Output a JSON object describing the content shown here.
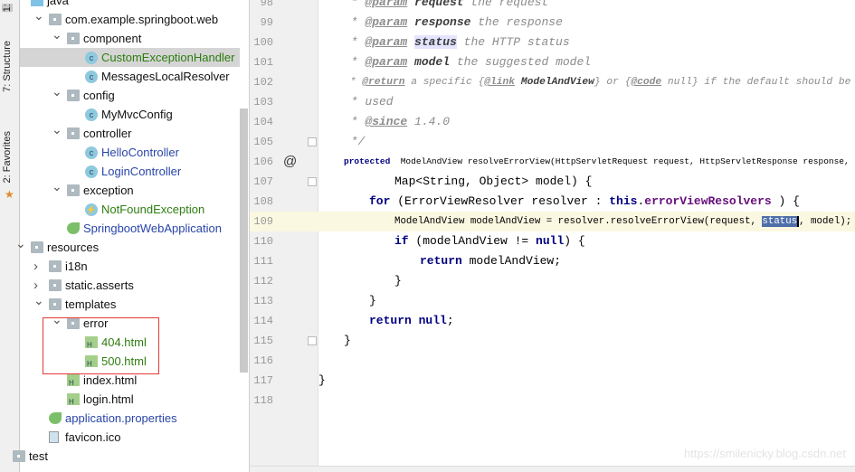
{
  "side_tabs": [
    {
      "label": "1:"
    },
    {
      "label": "7: Structure"
    },
    {
      "label": "2: Favorites"
    }
  ],
  "tree": [
    {
      "label": "java",
      "icon": "source-folder-icon",
      "text_x": 52,
      "arrow": "",
      "color": "black"
    },
    {
      "label": "com.example.springboot.web",
      "icon": "package-icon",
      "text_x": 72,
      "arrow": "down",
      "color": "black"
    },
    {
      "label": "component",
      "icon": "package-icon",
      "text_x": 92,
      "arrow": "down",
      "color": "black"
    },
    {
      "label": "CustomExceptionHandler",
      "icon": "class-icon",
      "text_x": 112,
      "arrow": "",
      "color": "green",
      "selected": true
    },
    {
      "label": "MessagesLocalResolver",
      "icon": "class-icon",
      "text_x": 112,
      "arrow": "",
      "color": "black"
    },
    {
      "label": "config",
      "icon": "package-icon",
      "text_x": 92,
      "arrow": "down",
      "color": "black"
    },
    {
      "label": "MyMvcConfig",
      "icon": "class-icon",
      "text_x": 112,
      "arrow": "",
      "color": "black"
    },
    {
      "label": "controller",
      "icon": "package-icon",
      "text_x": 92,
      "arrow": "down",
      "color": "black"
    },
    {
      "label": "HelloController",
      "icon": "class-icon",
      "text_x": 112,
      "arrow": "",
      "color": "blue"
    },
    {
      "label": "LoginController",
      "icon": "class-icon",
      "text_x": 112,
      "arrow": "",
      "color": "blue"
    },
    {
      "label": "exception",
      "icon": "package-icon",
      "text_x": 92,
      "arrow": "down",
      "color": "black"
    },
    {
      "label": "NotFoundException",
      "icon": "exception-class-icon",
      "text_x": 112,
      "arrow": "",
      "color": "green"
    },
    {
      "label": "SpringbootWebApplication",
      "icon": "spring-boot-app-icon",
      "text_x": 92,
      "arrow": "",
      "color": "blue"
    },
    {
      "label": "resources",
      "icon": "resources-folder-icon",
      "text_x": 52,
      "arrow": "down",
      "color": "black"
    },
    {
      "label": "i18n",
      "icon": "folder-icon",
      "text_x": 72,
      "arrow": "right",
      "color": "black"
    },
    {
      "label": "static.asserts",
      "icon": "folder-icon",
      "text_x": 72,
      "arrow": "right",
      "color": "black"
    },
    {
      "label": "templates",
      "icon": "folder-icon",
      "text_x": 72,
      "arrow": "down",
      "color": "black"
    },
    {
      "label": "error",
      "icon": "folder-icon",
      "text_x": 92,
      "arrow": "down",
      "color": "black"
    },
    {
      "label": "404.html",
      "icon": "html-file-icon",
      "text_x": 112,
      "arrow": "",
      "color": "green"
    },
    {
      "label": "500.html",
      "icon": "html-file-icon",
      "text_x": 112,
      "arrow": "",
      "color": "green"
    },
    {
      "label": "index.html",
      "icon": "html-file-icon",
      "text_x": 92,
      "arrow": "",
      "color": "black"
    },
    {
      "label": "login.html",
      "icon": "html-file-icon",
      "text_x": 92,
      "arrow": "",
      "color": "black"
    },
    {
      "label": "application.properties",
      "icon": "spring-properties-icon",
      "text_x": 72,
      "arrow": "",
      "color": "blue"
    },
    {
      "label": "favicon.ico",
      "icon": "image-file-icon",
      "text_x": 72,
      "arrow": "",
      "color": "black"
    },
    {
      "label": "test",
      "icon": "folder-icon",
      "text_x": 32,
      "arrow": "",
      "color": "black"
    }
  ],
  "editor": {
    "current_line": 109,
    "lines": [
      {
        "n": "98",
        "indent": 1,
        "tokens": [
          [
            "cm",
            " * "
          ],
          [
            "tag",
            "@param"
          ],
          [
            "cm",
            " "
          ],
          [
            "pn",
            "request"
          ],
          [
            "cm",
            " the request"
          ]
        ]
      },
      {
        "n": "99",
        "indent": 1,
        "tokens": [
          [
            "cm",
            " * "
          ],
          [
            "tag",
            "@param"
          ],
          [
            "cm",
            " "
          ],
          [
            "pn",
            "response"
          ],
          [
            "cm",
            " the response"
          ]
        ]
      },
      {
        "n": "100",
        "indent": 1,
        "tokens": [
          [
            "cm",
            " * "
          ],
          [
            "tag",
            "@param"
          ],
          [
            "cm",
            " "
          ],
          [
            "pnh",
            "status"
          ],
          [
            "cm",
            " the HTTP status"
          ]
        ]
      },
      {
        "n": "101",
        "indent": 1,
        "tokens": [
          [
            "cm",
            " * "
          ],
          [
            "tag",
            "@param"
          ],
          [
            "cm",
            " "
          ],
          [
            "pn",
            "model"
          ],
          [
            "cm",
            " the suggested model"
          ]
        ]
      },
      {
        "n": "102",
        "indent": 1,
        "tokens": [
          [
            "cm",
            " * "
          ],
          [
            "tag",
            "@return"
          ],
          [
            "cm",
            " a specific {"
          ],
          [
            "tag",
            "@link"
          ],
          [
            "pn",
            " ModelAndView"
          ],
          [
            "cm",
            "} or {"
          ],
          [
            "tag",
            "@code"
          ],
          [
            "cm",
            " null} if the default should be"
          ]
        ]
      },
      {
        "n": "103",
        "indent": 1,
        "tokens": [
          [
            "cm",
            " * used"
          ]
        ]
      },
      {
        "n": "104",
        "indent": 1,
        "tokens": [
          [
            "cm",
            " * "
          ],
          [
            "tag",
            "@since"
          ],
          [
            "cm",
            " 1.4.0"
          ]
        ]
      },
      {
        "n": "105",
        "indent": 1,
        "tokens": [
          [
            "cm",
            " */"
          ]
        ],
        "fold": true
      },
      {
        "n": "106",
        "indent": 1,
        "tokens": [
          [
            "kw",
            "protected"
          ],
          [
            "",
            "  ModelAndView resolveErrorView(HttpServletRequest request, HttpServletResponse response,"
          ]
        ],
        "gutter_icon": "@"
      },
      {
        "n": "107",
        "indent": 3,
        "tokens": [
          [
            "",
            "Map<String, Object> model) {"
          ]
        ],
        "fold": true
      },
      {
        "n": "108",
        "indent": 2,
        "tokens": [
          [
            "kw",
            "for"
          ],
          [
            "",
            " (ErrorViewResolver resolver : "
          ],
          [
            "kw",
            "this"
          ],
          [
            ".",
            ""
          ],
          [
            "fld",
            "errorViewResolvers"
          ],
          [
            "",
            " ) {"
          ]
        ]
      },
      {
        "n": "109",
        "indent": 3,
        "tokens": [
          [
            "",
            "ModelAndView modelAndView = resolver.resolveErrorView(request, "
          ],
          [
            "selw",
            "status"
          ],
          [
            "",
            ", model);"
          ]
        ],
        "bulb": true
      },
      {
        "n": "110",
        "indent": 3,
        "tokens": [
          [
            "kw",
            "if"
          ],
          [
            "",
            " (modelAndView != "
          ],
          [
            "kw",
            "null"
          ],
          [
            "",
            ") {"
          ]
        ]
      },
      {
        "n": "111",
        "indent": 4,
        "tokens": [
          [
            "kw",
            "return"
          ],
          [
            "",
            " modelAndView;"
          ]
        ]
      },
      {
        "n": "112",
        "indent": 3,
        "tokens": [
          [
            "",
            "}"
          ]
        ]
      },
      {
        "n": "113",
        "indent": 2,
        "tokens": [
          [
            "",
            "}"
          ]
        ]
      },
      {
        "n": "114",
        "indent": 2,
        "tokens": [
          [
            "kw",
            "return"
          ],
          [
            "kw",
            " null"
          ],
          [
            "",
            ";"
          ]
        ]
      },
      {
        "n": "115",
        "indent": 1,
        "tokens": [
          [
            "",
            "}"
          ]
        ],
        "fold": true
      },
      {
        "n": "116",
        "indent": 0,
        "tokens": []
      },
      {
        "n": "117",
        "indent": 0,
        "tokens": [
          [
            "",
            "}"
          ]
        ]
      },
      {
        "n": "118",
        "indent": 0,
        "tokens": []
      }
    ]
  },
  "watermark": "https://smilenicky.blog.csdn.net",
  "colors": {
    "selection": "#d5d5d5",
    "current_line": "#fbf8e1",
    "highlight_box": "#e53935",
    "keyword": "#000080",
    "modified_file": "#2d7d0f",
    "changed_file": "#2945a8"
  }
}
